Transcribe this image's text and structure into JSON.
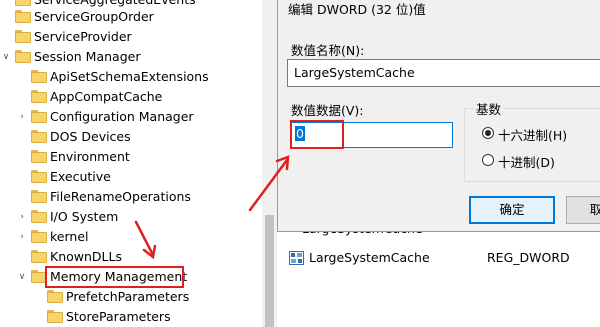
{
  "tree": {
    "items": [
      {
        "label": "ServiceAggregatedEvents",
        "chevron": ""
      },
      {
        "label": "ServiceGroupOrder",
        "chevron": ""
      },
      {
        "label": "ServiceProvider",
        "chevron": ""
      },
      {
        "label": "Session Manager",
        "chevron": "∨"
      },
      {
        "label": "ApiSetSchemaExtensions",
        "chevron": ""
      },
      {
        "label": "AppCompatCache",
        "chevron": ""
      },
      {
        "label": "Configuration Manager",
        "chevron": "›"
      },
      {
        "label": "DOS Devices",
        "chevron": ""
      },
      {
        "label": "Environment",
        "chevron": ""
      },
      {
        "label": "Executive",
        "chevron": ""
      },
      {
        "label": "FileRenameOperations",
        "chevron": ""
      },
      {
        "label": "I/O System",
        "chevron": "›"
      },
      {
        "label": "kernel",
        "chevron": "›"
      },
      {
        "label": "KnownDLLs",
        "chevron": ""
      },
      {
        "label": "Memory Management",
        "chevron": "∨"
      },
      {
        "label": "PrefetchParameters",
        "chevron": ""
      },
      {
        "label": "StoreParameters",
        "chevron": ""
      }
    ]
  },
  "values_list": {
    "partial_row": "LargeSystemCache",
    "row_name": "LargeSystemCache",
    "row_type": "REG_DWORD"
  },
  "dialog": {
    "title": "编辑 DWORD (32 位)值",
    "name_label": "数值名称(N):",
    "name_value": "LargeSystemCache",
    "data_label": "数值数据(V):",
    "data_value": "0",
    "base_label": "基数",
    "radio_hex": "十六进制(H)",
    "radio_dec": "十进制(D)",
    "radio_selected": "hex",
    "ok_label": "确定",
    "cancel_label": "取"
  },
  "colors": {
    "annotation_red": "#e02020",
    "selection_blue": "#0078d7",
    "folder_yellow": "#f7d56c"
  }
}
